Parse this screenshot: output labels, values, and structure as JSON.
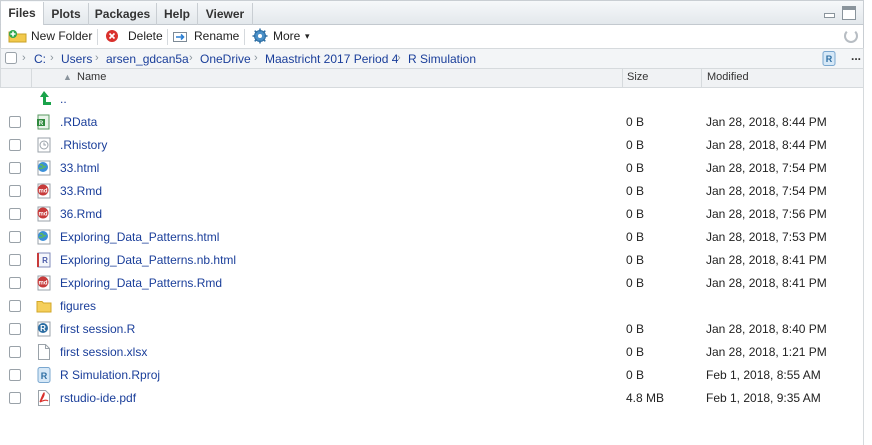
{
  "tabs": [
    {
      "label": "Files",
      "active": true
    },
    {
      "label": "Plots",
      "active": false
    },
    {
      "label": "Packages",
      "active": false
    },
    {
      "label": "Help",
      "active": false
    },
    {
      "label": "Viewer",
      "active": false
    }
  ],
  "toolbar": {
    "new_folder": "New Folder",
    "delete": "Delete",
    "rename": "Rename",
    "more": "More",
    "more_caret": "▾"
  },
  "breadcrumb": {
    "items": [
      "C:",
      "Users",
      "arsen_gdcan5a",
      "OneDrive",
      "Maastricht 2017 Period 4",
      "R Simulation"
    ],
    "ellipsis": "..."
  },
  "columns": {
    "name": "Name",
    "size": "Size",
    "modified": "Modified",
    "sort_indicator": "▲"
  },
  "files": [
    {
      "name": "..",
      "size": "",
      "modified": "",
      "icon": "up-arrow-icon",
      "checkbox": false
    },
    {
      "name": ".RData",
      "size": "0 B",
      "modified": "Jan 28, 2018, 8:44 PM",
      "icon": "rdata-icon",
      "checkbox": true
    },
    {
      "name": ".Rhistory",
      "size": "0 B",
      "modified": "Jan 28, 2018, 8:44 PM",
      "icon": "rhistory-icon",
      "checkbox": true
    },
    {
      "name": "33.html",
      "size": "0 B",
      "modified": "Jan 28, 2018, 7:54 PM",
      "icon": "html-globe-icon",
      "checkbox": true
    },
    {
      "name": "33.Rmd",
      "size": "0 B",
      "modified": "Jan 28, 2018, 7:54 PM",
      "icon": "rmd-icon",
      "checkbox": true
    },
    {
      "name": "36.Rmd",
      "size": "0 B",
      "modified": "Jan 28, 2018, 7:56 PM",
      "icon": "rmd-icon",
      "checkbox": true
    },
    {
      "name": "Exploring_Data_Patterns.html",
      "size": "0 B",
      "modified": "Jan 28, 2018, 7:53 PM",
      "icon": "html-globe-icon",
      "checkbox": true
    },
    {
      "name": "Exploring_Data_Patterns.nb.html",
      "size": "0 B",
      "modified": "Jan 28, 2018, 8:41 PM",
      "icon": "notebook-icon",
      "checkbox": true
    },
    {
      "name": "Exploring_Data_Patterns.Rmd",
      "size": "0 B",
      "modified": "Jan 28, 2018, 8:41 PM",
      "icon": "rmd-icon",
      "checkbox": true
    },
    {
      "name": "figures",
      "size": "",
      "modified": "",
      "icon": "folder-icon",
      "checkbox": true
    },
    {
      "name": "first session.R",
      "size": "0 B",
      "modified": "Jan 28, 2018, 8:40 PM",
      "icon": "r-script-icon",
      "checkbox": true
    },
    {
      "name": "first session.xlsx",
      "size": "0 B",
      "modified": "Jan 28, 2018, 1:21 PM",
      "icon": "blank-file-icon",
      "checkbox": true
    },
    {
      "name": "R Simulation.Rproj",
      "size": "0 B",
      "modified": "Feb 1, 2018, 8:55 AM",
      "icon": "rproj-icon",
      "checkbox": true
    },
    {
      "name": "rstudio-ide.pdf",
      "size": "4.8 MB",
      "modified": "Feb 1, 2018, 9:35 AM",
      "icon": "pdf-icon",
      "checkbox": true
    }
  ],
  "colors": {
    "link": "#1a3e9a",
    "tab_bg": "#e3e8ec",
    "accent_green": "#1aa34a"
  }
}
